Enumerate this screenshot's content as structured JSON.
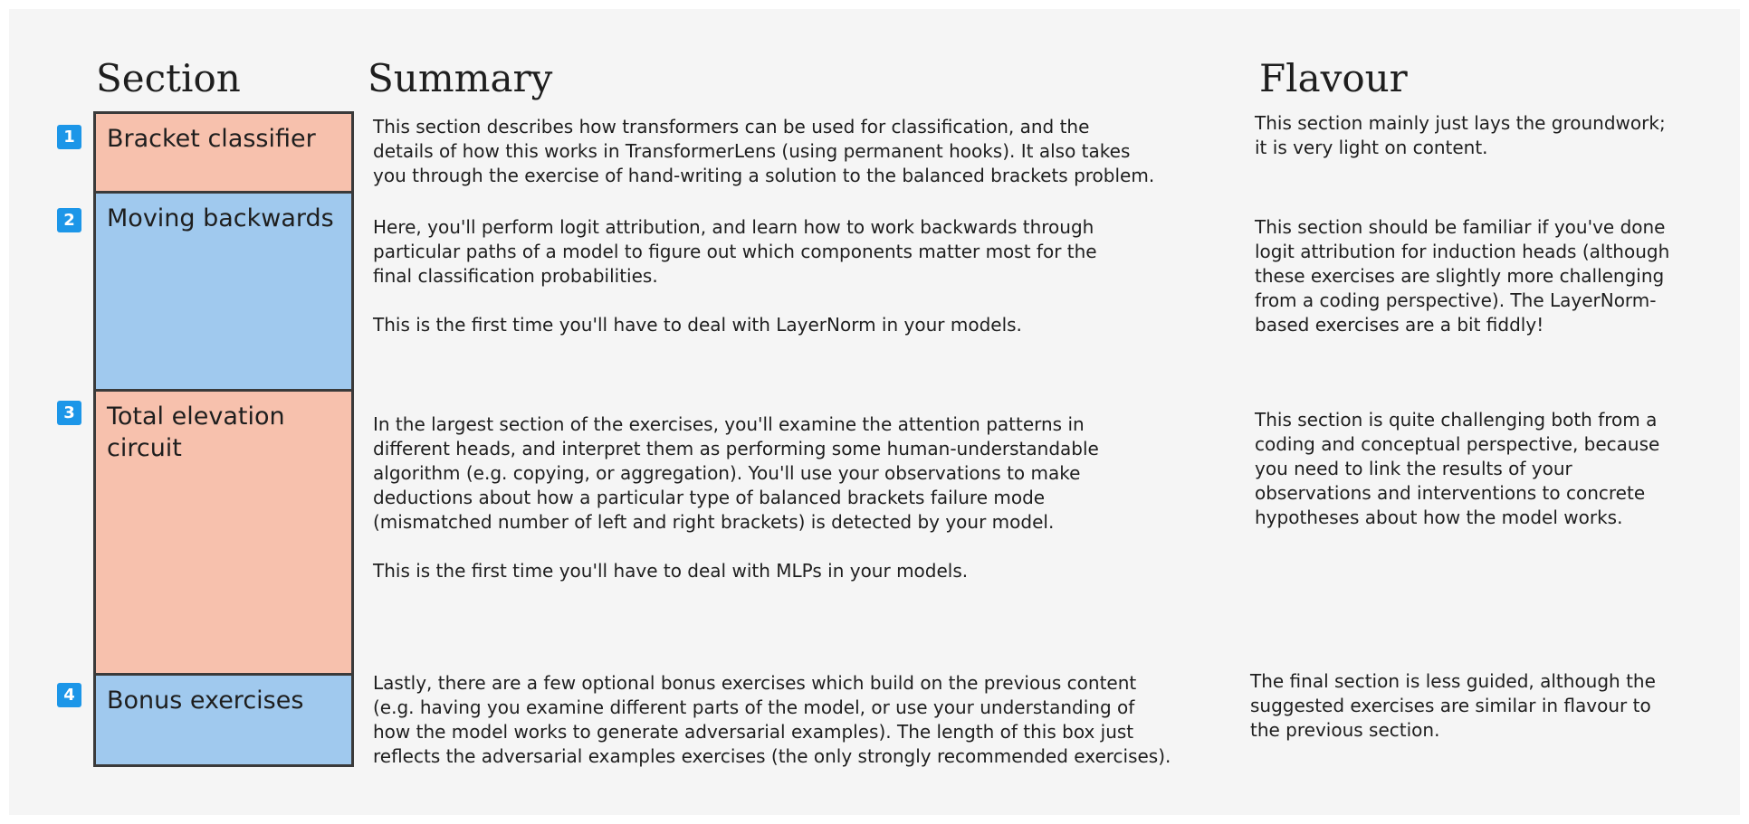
{
  "colors": {
    "salmon": "#f7c1ad",
    "blue": "#a0c9ee",
    "badge": "#1c96e8"
  },
  "headers": {
    "section": "Section",
    "summary": "Summary",
    "flavour": "Flavour"
  },
  "rows": [
    {
      "number": "1",
      "title": "Bracket classifier",
      "summary": "This section describes how transformers can be used for classification, and the\ndetails of how this works in TransformerLens (using permanent hooks). It also takes\nyou through the exercise of hand-writing a solution to the balanced brackets problem.",
      "flavour": "This section mainly just lays the groundwork;\nit is very light on content."
    },
    {
      "number": "2",
      "title": "Moving backwards",
      "summary": "Here, you'll perform logit attribution, and learn how to work backwards through\nparticular paths of a model to figure out which components matter most for the\nfinal classification probabilities.\n\nThis is the first time you'll have to deal with LayerNorm in your models.",
      "flavour": "This section should be familiar if you've done\nlogit attribution for induction heads (although\nthese exercises are slightly more challenging\nfrom a coding perspective). The LayerNorm-\nbased exercises are a bit fiddly!"
    },
    {
      "number": "3",
      "title": "Total elevation\ncircuit",
      "summary": "In the largest section of the exercises, you'll examine the attention patterns in\ndifferent heads, and interpret them as performing some human-understandable\nalgorithm (e.g. copying, or aggregation). You'll use your observations to make\ndeductions about how a particular type of balanced brackets failure mode\n(mismatched number of left and right brackets) is detected by your model.\n\nThis is the first time you'll have to deal with MLPs in your models.",
      "flavour": "This section is quite challenging both from a\ncoding and conceptual perspective, because\nyou need to link the results of your\nobservations and interventions to concrete\nhypotheses about how the model works."
    },
    {
      "number": "4",
      "title": "Bonus exercises",
      "summary": "Lastly, there are a few optional bonus exercises which build on the previous content\n(e.g. having you examine different parts of the model, or use your understanding of\nhow the model works to generate adversarial examples). The length of this box just\nreflects the adversarial examples exercises (the only strongly recommended exercises).",
      "flavour": "The final section is less guided, although the\nsuggested exercises are similar in flavour to\nthe previous section."
    }
  ]
}
